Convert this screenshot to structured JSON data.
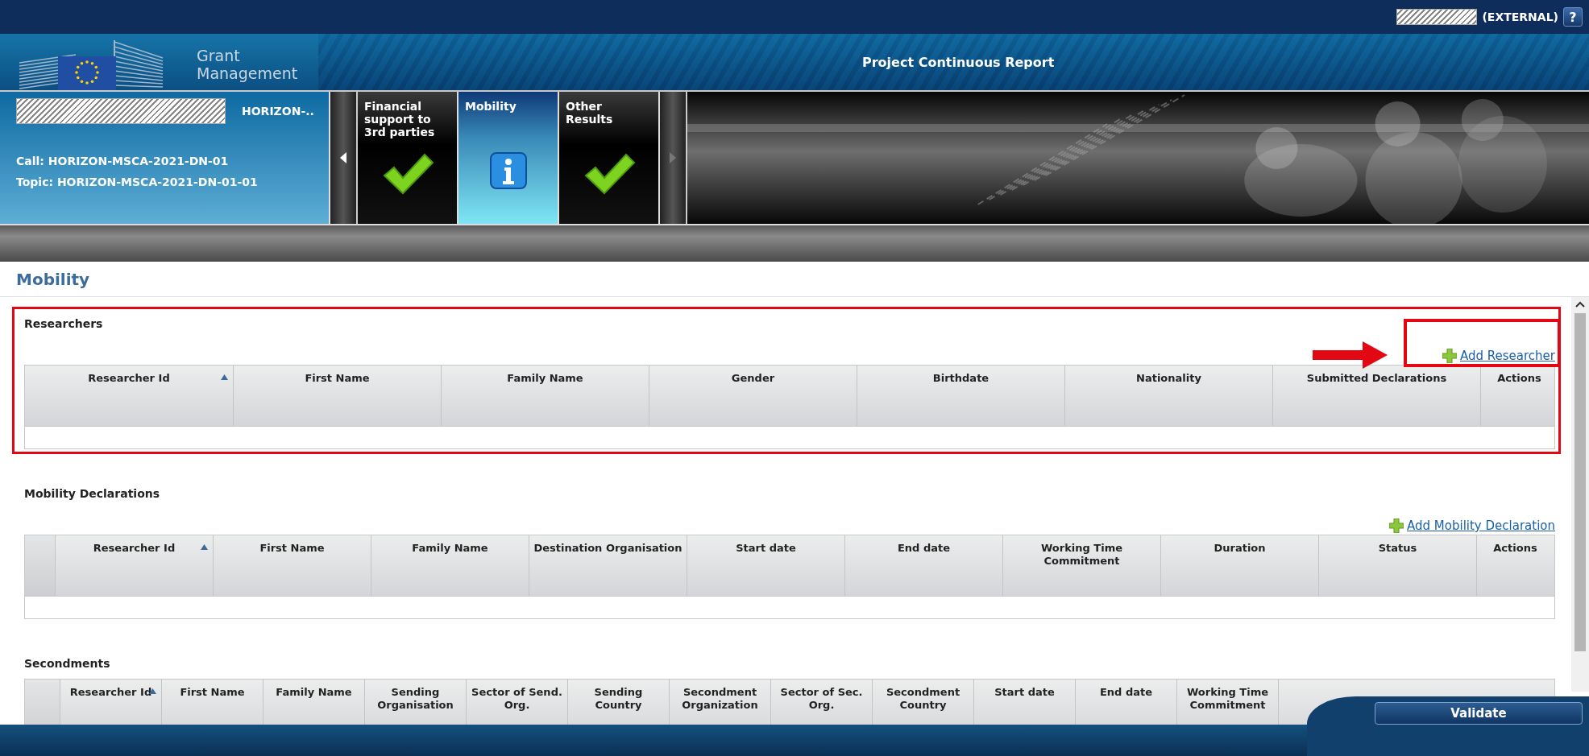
{
  "top_bar": {
    "user_suffix": "(EXTERNAL)",
    "help": "?"
  },
  "header": {
    "brand_lines": [
      "Grant",
      "Management"
    ],
    "title": "Project Continuous Report"
  },
  "project": {
    "acronym": "HORIZON-..",
    "call": "Call: HORIZON-MSCA-2021-DN-01",
    "topic": "Topic: HORIZON-MSCA-2021-DN-01-01"
  },
  "tabs": [
    {
      "label": "Financial support to 3rd parties",
      "selected": false,
      "kind": "complete"
    },
    {
      "label": "Mobility",
      "selected": true,
      "kind": "info"
    },
    {
      "label": "Other Results",
      "selected": false,
      "kind": "complete"
    }
  ],
  "page_title": "Mobility",
  "sections": [
    {
      "title": "Researchers",
      "highlighted": true,
      "link_highlighted": true,
      "add_link": "Add Researcher",
      "select_column": false,
      "columns": [
        {
          "label": "Researcher Id",
          "sorted": true
        },
        {
          "label": "First Name",
          "sorted": false
        },
        {
          "label": "Family Name",
          "sorted": false
        },
        {
          "label": "Gender",
          "sorted": false
        },
        {
          "label": "Birthdate",
          "sorted": false
        },
        {
          "label": "Nationality",
          "sorted": false
        },
        {
          "label": "Submitted Declarations",
          "sorted": false
        },
        {
          "label": "Actions",
          "sorted": false
        }
      ]
    },
    {
      "title": "Mobility Declarations",
      "highlighted": false,
      "link_highlighted": false,
      "add_link": "Add Mobility Declaration",
      "select_column": true,
      "columns": [
        {
          "label": "Researcher Id",
          "sorted": true
        },
        {
          "label": "First Name",
          "sorted": false
        },
        {
          "label": "Family Name",
          "sorted": false
        },
        {
          "label": "Destination Organisation",
          "sorted": false
        },
        {
          "label": "Start date",
          "sorted": false
        },
        {
          "label": "End date",
          "sorted": false
        },
        {
          "label": "Working Time Commitment",
          "sorted": false
        },
        {
          "label": "Duration",
          "sorted": false
        },
        {
          "label": "Status",
          "sorted": false
        },
        {
          "label": "Actions",
          "sorted": false
        }
      ]
    },
    {
      "title": "Secondments",
      "highlighted": false,
      "link_highlighted": false,
      "select_column": true,
      "columns": [
        {
          "label": "Researcher Id",
          "sorted": true
        },
        {
          "label": "First Name",
          "sorted": false
        },
        {
          "label": "Family Name",
          "sorted": false
        },
        {
          "label": "Sending Organisation",
          "sorted": false
        },
        {
          "label": "Sector of Send. Org.",
          "sorted": false
        },
        {
          "label": "Sending Country",
          "sorted": false
        },
        {
          "label": "Secondment Organization",
          "sorted": false
        },
        {
          "label": "Sector of Sec. Org.",
          "sorted": false
        },
        {
          "label": "Secondment Country",
          "sorted": false
        },
        {
          "label": "Start date",
          "sorted": false
        },
        {
          "label": "End date",
          "sorted": false
        },
        {
          "label": "Working Time Commitment",
          "sorted": false
        }
      ]
    }
  ],
  "validate_button": "Validate"
}
